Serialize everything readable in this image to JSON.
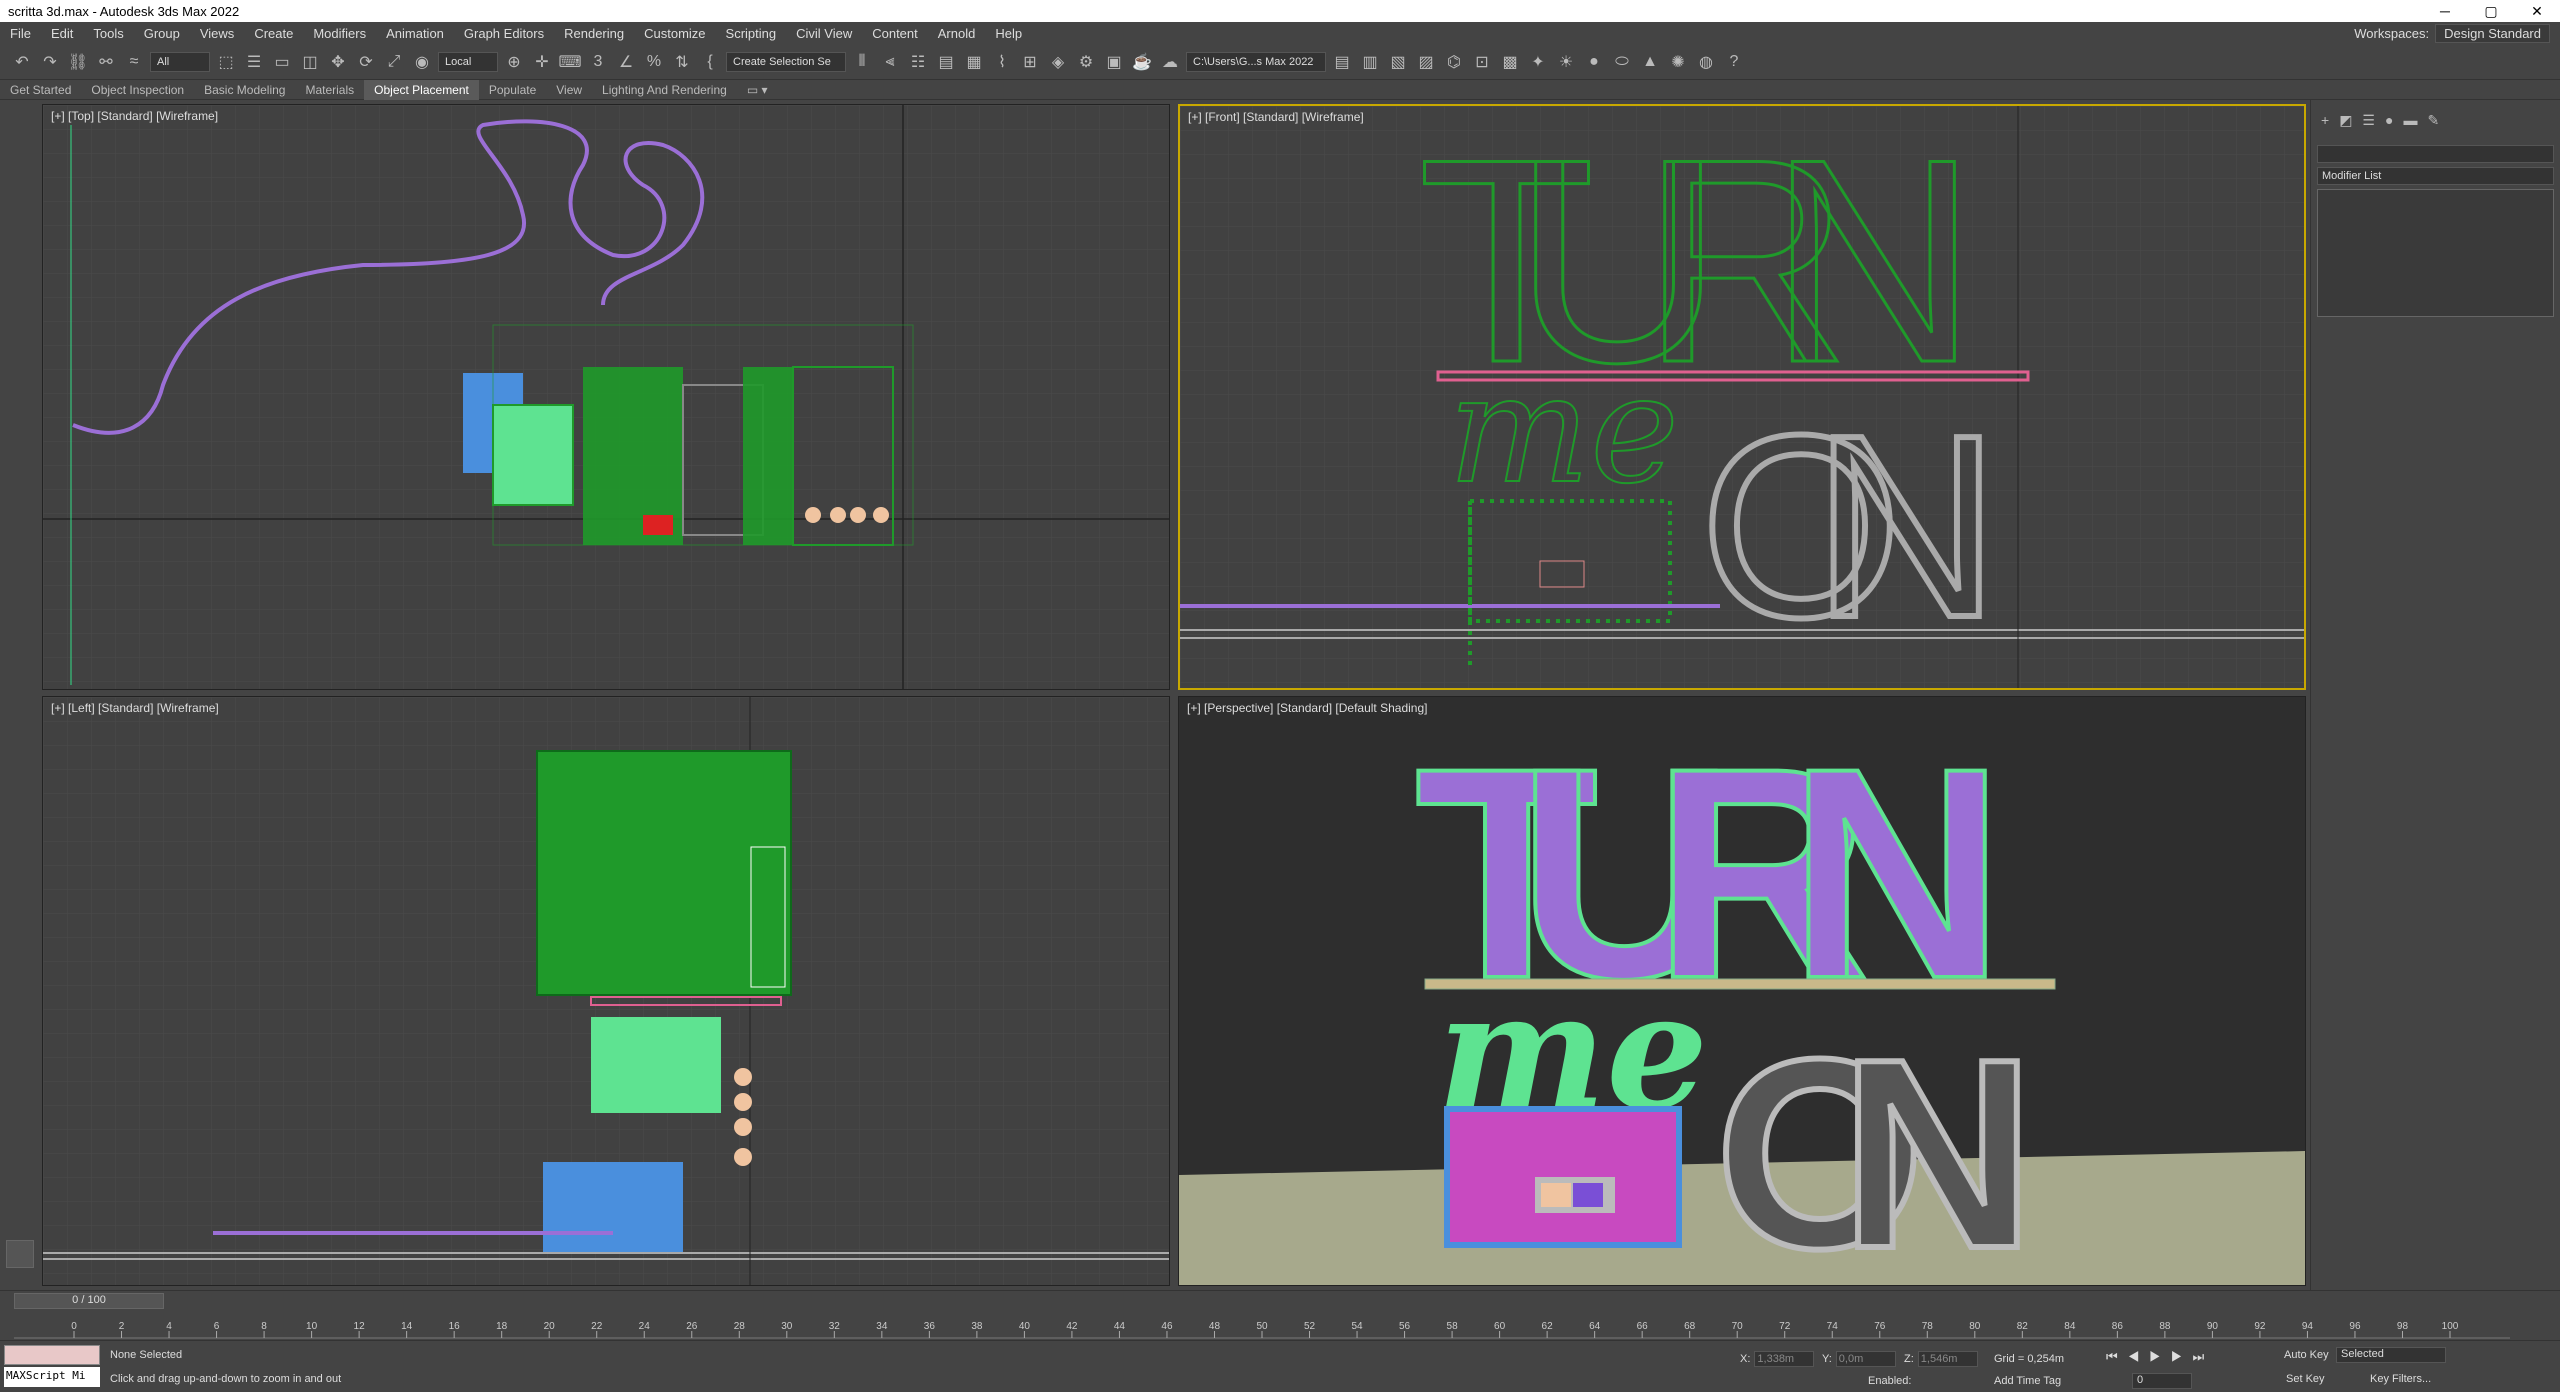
{
  "window": {
    "title": "scritta 3d.max - Autodesk 3ds Max 2022"
  },
  "menu": [
    "File",
    "Edit",
    "Tools",
    "Group",
    "Views",
    "Create",
    "Modifiers",
    "Animation",
    "Graph Editors",
    "Rendering",
    "Customize",
    "Scripting",
    "Civil View",
    "Content",
    "Arnold",
    "Help"
  ],
  "workspace": {
    "label": "Workspaces:",
    "value": "Design Standard"
  },
  "toolbar": {
    "filter": "All",
    "ref_coord": "Local",
    "selection_set": "Create Selection Se",
    "path": "C:\\Users\\G...s Max 2022"
  },
  "ribbon": [
    "Get Started",
    "Object Inspection",
    "Basic Modeling",
    "Materials",
    "Object Placement",
    "Populate",
    "View",
    "Lighting And Rendering"
  ],
  "ribbon_active": "Object Placement",
  "viewports": {
    "top": "[+] [Top] [Standard] [Wireframe]",
    "front": "[+] [Front] [Standard] [Wireframe]",
    "left": "[+] [Left] [Standard] [Wireframe]",
    "perspective": "[+] [Perspective] [Standard] [Default Shading]"
  },
  "scene_text": {
    "word1": "TURN",
    "word2": "me",
    "word3": "ON"
  },
  "command_panel": {
    "modifier_list": "Modifier List"
  },
  "timeline": {
    "frame": "0 / 100",
    "ticks": [
      0,
      2,
      4,
      6,
      8,
      10,
      12,
      14,
      16,
      18,
      20,
      22,
      24,
      26,
      28,
      30,
      32,
      34,
      36,
      38,
      40,
      42,
      44,
      46,
      48,
      50,
      52,
      54,
      56,
      58,
      60,
      62,
      64,
      66,
      68,
      70,
      72,
      74,
      76,
      78,
      80,
      82,
      84,
      86,
      88,
      90,
      92,
      94,
      96,
      98,
      100
    ]
  },
  "status": {
    "selection": "None Selected",
    "hint": "Click and drag up-and-down to zoom in and out",
    "maxscript": "MAXScript Mi",
    "x": "1,338m",
    "y": "0,0m",
    "z": "1,546m",
    "grid": "Grid = 0,254m",
    "add_time_tag": "Add Time Tag",
    "enabled": "Enabled:",
    "auto_key": "Auto Key",
    "set_key": "Set Key",
    "selected": "Selected",
    "key_filters": "Key Filters...",
    "frame_field": "0"
  },
  "colors": {
    "accent": "#c8a800",
    "purple": "#9b6fd6",
    "green": "#1f9a2a",
    "mint": "#5ee391"
  }
}
